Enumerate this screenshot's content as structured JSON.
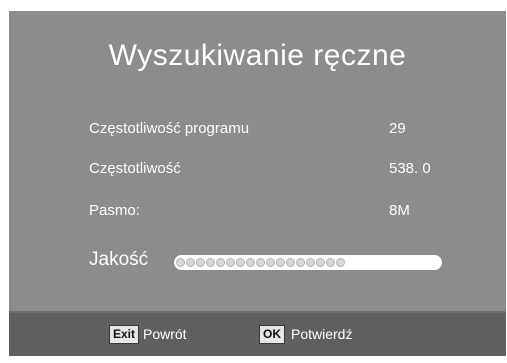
{
  "dialog": {
    "title": "Wyszukiwanie ręczne",
    "rows": [
      {
        "label": "Częstotliwość programu",
        "value": "29"
      },
      {
        "label": "Częstotliwość",
        "value": "538. 0"
      },
      {
        "label": "Pasmo:",
        "value": "8M"
      }
    ],
    "quality": {
      "label": "Jakość",
      "level": 0.64
    }
  },
  "footer": {
    "exit_key": "Exit",
    "exit_label": "Powrót",
    "ok_key": "OK",
    "ok_label": "Potwierdź"
  },
  "colors": {
    "panel": "#8c8c8c",
    "footer": "#5f5f5f",
    "text": "#ffffff"
  }
}
